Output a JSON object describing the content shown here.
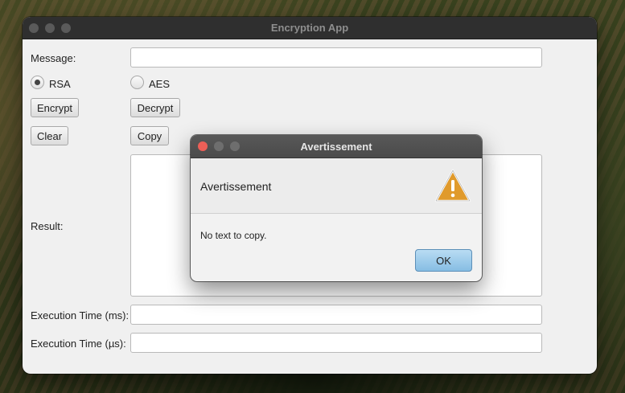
{
  "window": {
    "title": "Encryption App"
  },
  "form": {
    "message_label": "Message:",
    "message_value": "",
    "rsa_label": "RSA",
    "aes_label": "AES",
    "selected_algorithm": "RSA",
    "encrypt_label": "Encrypt",
    "decrypt_label": "Decrypt",
    "clear_label": "Clear",
    "copy_label": "Copy",
    "result_label": "Result:",
    "exec_ms_label": "Execution Time (ms):",
    "exec_us_label": "Execution Time (µs):"
  },
  "dialog": {
    "title": "Avertissement",
    "header": "Avertissement",
    "message": "No text to copy.",
    "ok_label": "OK",
    "icon": "warning-icon"
  },
  "colors": {
    "close_red": "#ec5f57",
    "warning_orange": "#e09a2c",
    "ok_blue": "#86bde3"
  }
}
